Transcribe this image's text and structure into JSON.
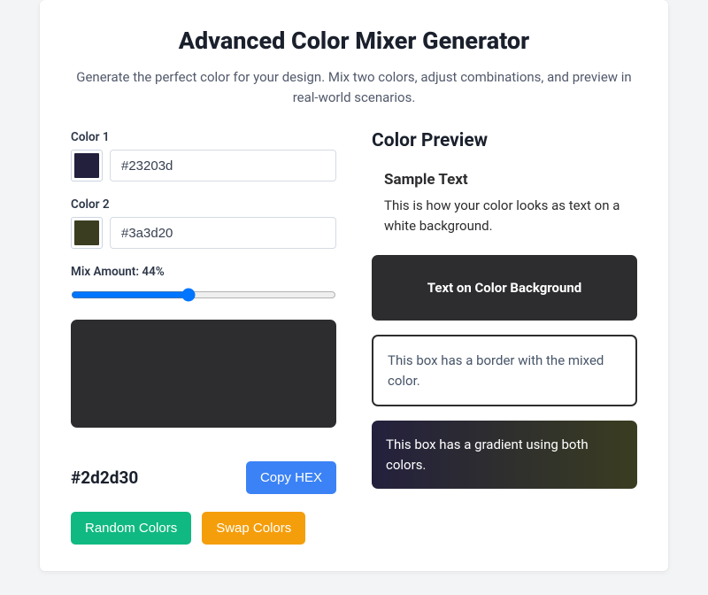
{
  "header": {
    "title": "Advanced Color Mixer Generator",
    "subtitle": "Generate the perfect color for your design. Mix two colors, adjust combinations, and preview in real-world scenarios."
  },
  "form": {
    "color1_label": "Color 1",
    "color1_value": "#23203d",
    "color1_hex": "#23203d",
    "color2_label": "Color 2",
    "color2_value": "#3a3d20",
    "color2_hex": "#3a3d20",
    "mix_label": "Mix Amount: 44%",
    "mix_value": "44"
  },
  "result": {
    "hex": "#2d2d30",
    "copy_label": "Copy HEX",
    "random_label": "Random Colors",
    "swap_label": "Swap Colors"
  },
  "preview": {
    "title": "Color Preview",
    "sample_header": "Sample Text",
    "sample_para": "This is how your color looks as text on a white background.",
    "on_color": "Text on Color Background",
    "border_text": "This box has a border with the mixed color.",
    "gradient_text": "This box has a gradient using both colors."
  },
  "colors": {
    "mixed": "#2d2d30",
    "c1": "#23203d",
    "c2": "#3a3d20"
  }
}
